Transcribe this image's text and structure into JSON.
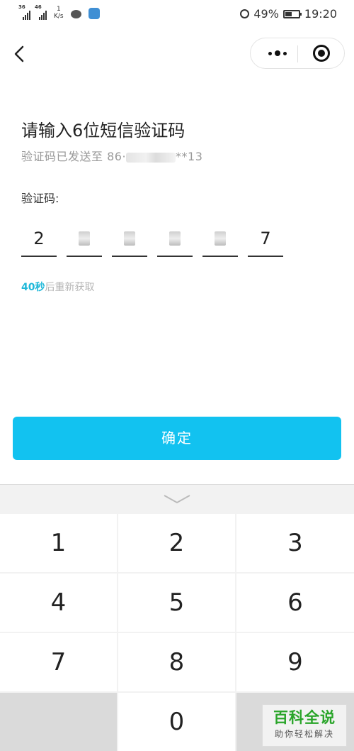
{
  "status_bar": {
    "sim1": "36",
    "sim2": "46",
    "net_speed_value": "1",
    "net_speed_unit": "K/s",
    "battery": "49%",
    "time": "19:20"
  },
  "icons": {
    "back": "back-arrow-icon",
    "more": "more-dots-icon",
    "close": "close-target-icon",
    "keyboard_hide": "chevron-down-icon"
  },
  "page": {
    "title": "请输入6位短信验证码",
    "sent_prefix": "验证码已发送至 86·",
    "sent_suffix": "**13",
    "code_label": "验证码:",
    "code_digits": [
      "2",
      "",
      "",
      "",
      "",
      "7"
    ],
    "resend_countdown": "40秒",
    "resend_text": "后重新获取",
    "confirm_label": "确定"
  },
  "keypad": {
    "keys": [
      "1",
      "2",
      "3",
      "4",
      "5",
      "6",
      "7",
      "8",
      "9",
      "",
      "0",
      ""
    ]
  },
  "watermark": {
    "main": "百科全说",
    "sub": "助你轻松解决"
  },
  "colors": {
    "accent": "#12c2f0",
    "countdown": "#1fb8d9",
    "watermark": "#2aa52a"
  }
}
